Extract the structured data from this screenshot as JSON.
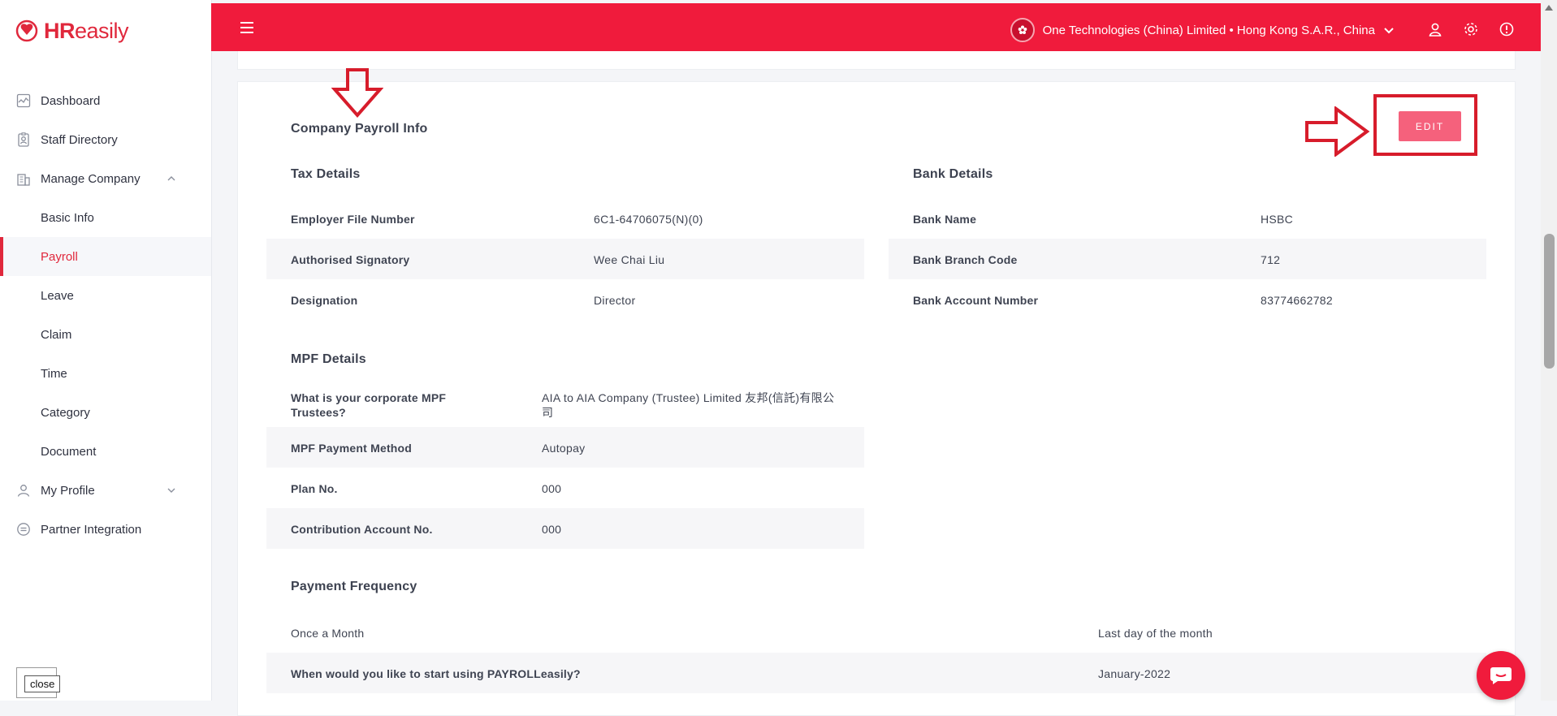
{
  "app": {
    "logo_text_bold": "HR",
    "logo_text_light": "easily"
  },
  "sidebar": {
    "items": [
      {
        "label": "Dashboard",
        "icon": "dashboard-icon"
      },
      {
        "label": "Staff Directory",
        "icon": "staff-directory-icon"
      },
      {
        "label": "Manage Company",
        "icon": "building-icon",
        "expanded": true
      },
      {
        "label": "Basic Info"
      },
      {
        "label": "Payroll",
        "active": true
      },
      {
        "label": "Leave"
      },
      {
        "label": "Claim"
      },
      {
        "label": "Time"
      },
      {
        "label": "Category"
      },
      {
        "label": "Document"
      },
      {
        "label": "My Profile",
        "icon": "user-icon",
        "expanded": false
      },
      {
        "label": "Partner Integration",
        "icon": "integration-icon"
      }
    ],
    "close_label": "close"
  },
  "topbar": {
    "company": "One Technologies (China) Limited • Hong Kong S.A.R., China",
    "flag_icon": "hong-kong-flag-icon"
  },
  "payroll": {
    "title": "Company Payroll Info",
    "edit_label": "EDIT",
    "tax": {
      "title": "Tax Details",
      "rows": [
        {
          "label": "Employer File Number",
          "value": "6C1-64706075(N)(0)"
        },
        {
          "label": "Authorised Signatory",
          "value": "Wee Chai Liu"
        },
        {
          "label": "Designation",
          "value": "Director"
        }
      ]
    },
    "bank": {
      "title": "Bank Details",
      "rows": [
        {
          "label": "Bank Name",
          "value": "HSBC"
        },
        {
          "label": "Bank Branch Code",
          "value": "712"
        },
        {
          "label": "Bank Account Number",
          "value": "83774662782"
        }
      ]
    },
    "mpf": {
      "title": "MPF Details",
      "rows": [
        {
          "label": "What is your corporate MPF Trustees?",
          "value": "AIA to AIA Company (Trustee) Limited 友邦(信託)有限公司"
        },
        {
          "label": "MPF Payment Method",
          "value": "Autopay"
        },
        {
          "label": "Plan No.",
          "value": "000"
        },
        {
          "label": "Contribution Account No.",
          "value": "000"
        }
      ]
    },
    "frequency": {
      "title": "Payment Frequency",
      "rows": [
        {
          "label": "Once a Month",
          "value": "Last day of the month"
        },
        {
          "label": "When would you like to start using PAYROLLeasily?",
          "value": "January-2022"
        }
      ]
    }
  },
  "colors": {
    "brand": "#f01b3c",
    "edit_button": "#f5617c",
    "annotation": "#d71c2b"
  }
}
